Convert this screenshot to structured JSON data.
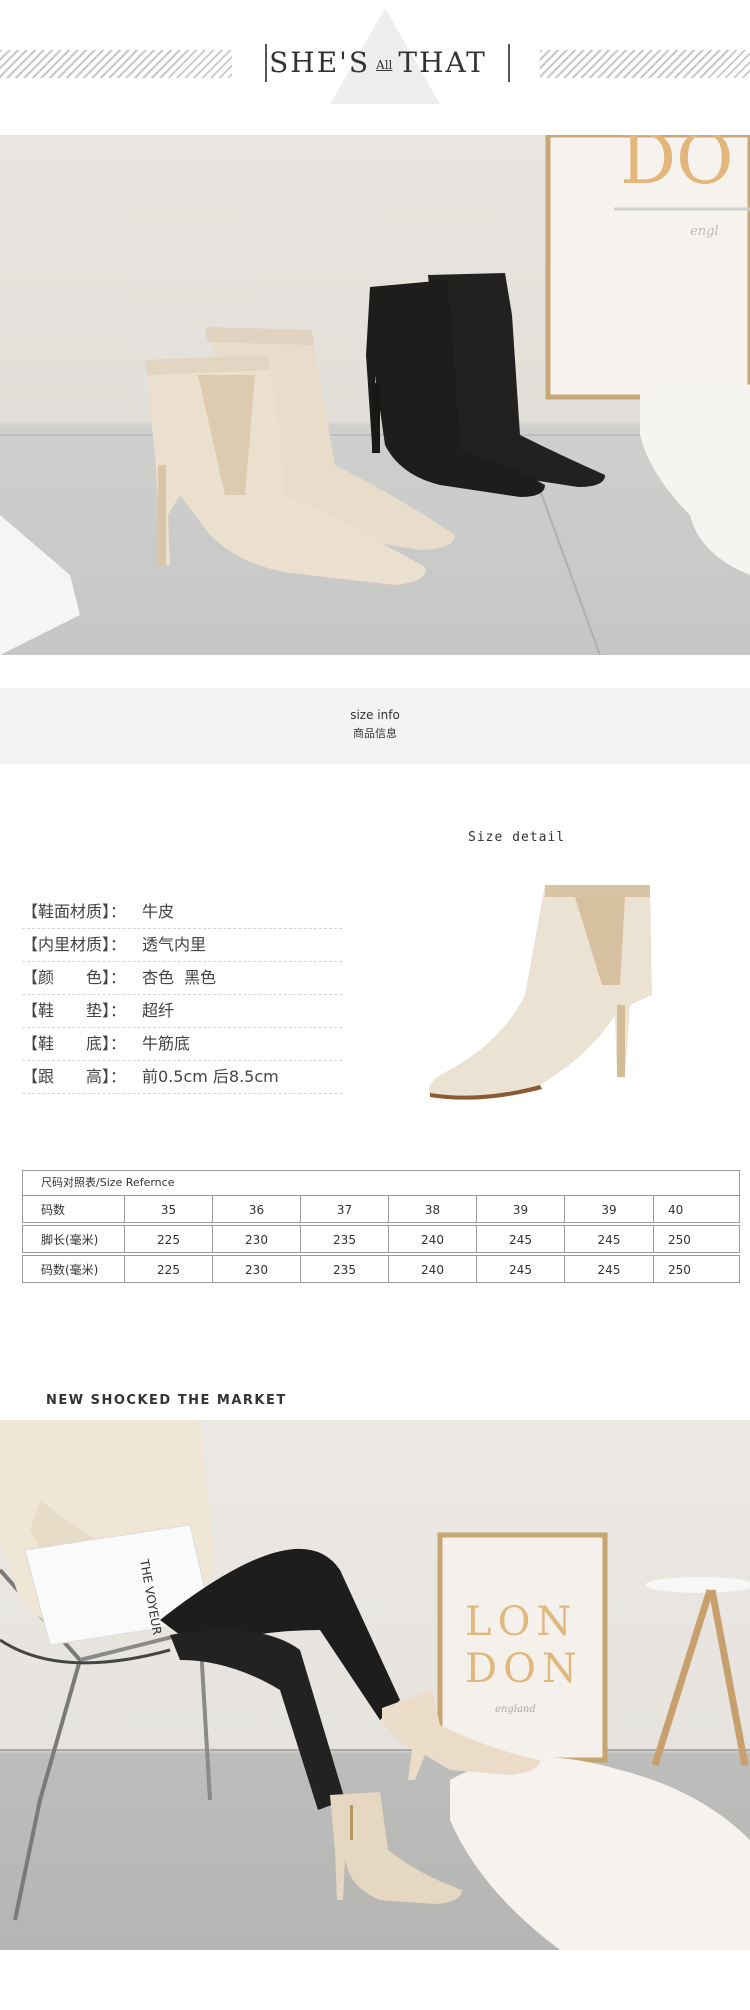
{
  "header": {
    "brand_left": "SHE'S",
    "brand_mid": "All",
    "brand_right": "THAT"
  },
  "photo1": {
    "poster_text": "DO",
    "poster_subtext": "engl"
  },
  "size_info": {
    "title_en": "size info",
    "title_zh": "商品信息"
  },
  "size_detail_label": "Size detail",
  "specs": [
    {
      "label": "【鞋面材质】：",
      "value": "牛皮"
    },
    {
      "label": "【内里材质】：",
      "value": "透气内里"
    },
    {
      "label": "【颜　　色】：",
      "value": "杏色  黑色"
    },
    {
      "label": "【鞋　　垫】：",
      "value": "超纤"
    },
    {
      "label": "【鞋　　底】：",
      "value": "牛筋底"
    },
    {
      "label": "【跟　　高】：",
      "value": "前0.5cm 后8.5cm"
    }
  ],
  "size_table": {
    "title": "尺码对照表/Size Refernce",
    "rows": [
      [
        "码数",
        "35",
        "36",
        "37",
        "38",
        "39",
        "39",
        "40"
      ],
      [
        "脚长(毫米)",
        "225",
        "230",
        "235",
        "240",
        "245",
        "245",
        "250"
      ],
      [
        "码数(毫米)",
        "225",
        "230",
        "235",
        "240",
        "245",
        "245",
        "250"
      ]
    ]
  },
  "market_heading": "NEW SHOCKED THE MARKET",
  "photo2": {
    "magazine_text": "THE VOYEUR",
    "poster_line1": "LON",
    "poster_line2": "DON",
    "poster_sub": "england"
  },
  "colors": {
    "beige": "#e3d6c4",
    "black_suede": "#1f1c1c",
    "accent_gold": "#d8b98a"
  }
}
